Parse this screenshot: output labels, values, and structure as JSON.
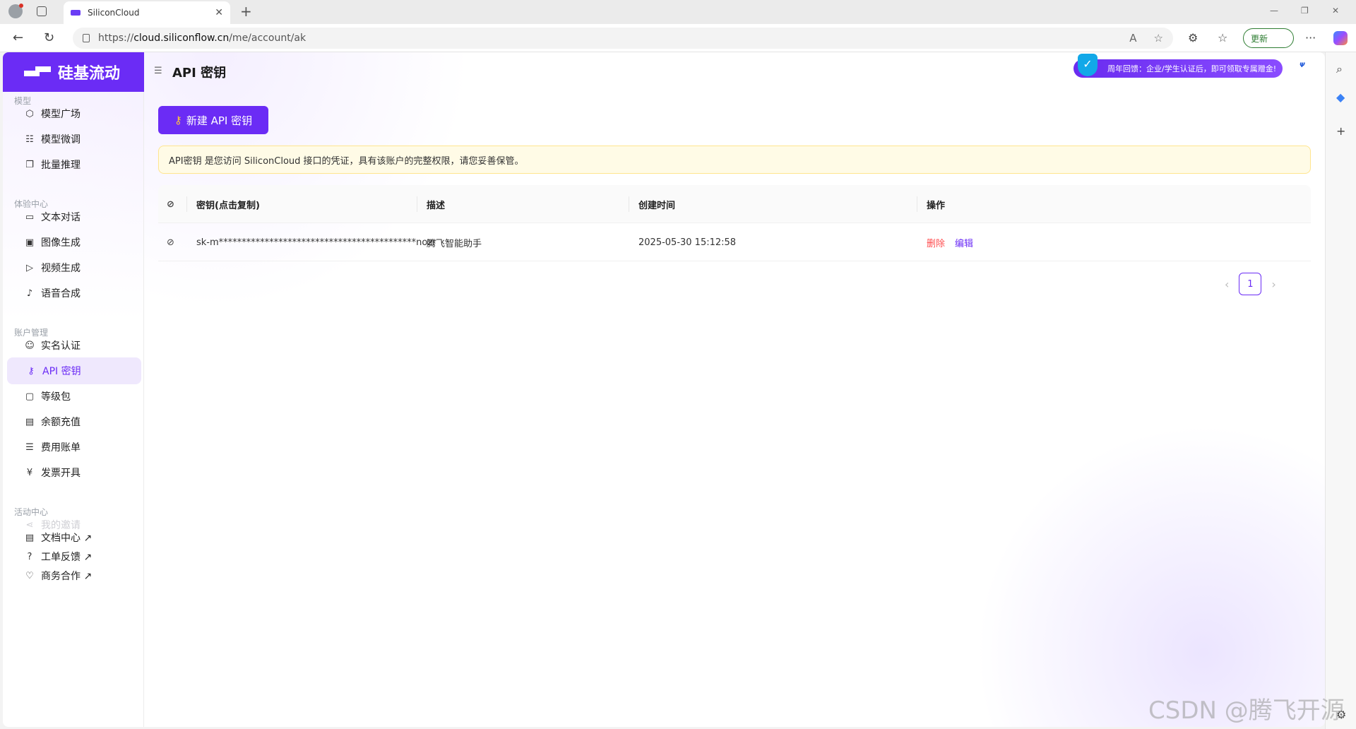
{
  "browser": {
    "tab_title": "SiliconCloud",
    "url_prefix": "https://",
    "url_host": "cloud.siliconflow.cn",
    "url_path": "/me/account/ak",
    "update_label": "更新"
  },
  "brand": {
    "name": "硅基流动"
  },
  "sidebar": {
    "sections": [
      {
        "title": "模型"
      },
      {
        "title": "体验中心"
      },
      {
        "title": "账户管理"
      },
      {
        "title": "活动中心"
      }
    ],
    "items": [
      {
        "label": "模型广场",
        "icon": "cube-icon"
      },
      {
        "label": "模型微调",
        "icon": "sliders-icon"
      },
      {
        "label": "批量推理",
        "icon": "copy-icon"
      },
      {
        "label": "文本对话",
        "icon": "chat-icon"
      },
      {
        "label": "图像生成",
        "icon": "image-icon"
      },
      {
        "label": "视频生成",
        "icon": "video-icon"
      },
      {
        "label": "语音合成",
        "icon": "mic-icon"
      },
      {
        "label": "实名认证",
        "icon": "user-check-icon"
      },
      {
        "label": "API 密钥",
        "icon": "key-icon"
      },
      {
        "label": "等级包",
        "icon": "wallet-icon"
      },
      {
        "label": "余额充值",
        "icon": "card-icon"
      },
      {
        "label": "费用账单",
        "icon": "bill-icon"
      },
      {
        "label": "发票开具",
        "icon": "invoice-icon"
      },
      {
        "label": "我的邀请",
        "icon": "share-icon"
      }
    ],
    "footer_links": [
      {
        "label": "文档中心 ↗",
        "icon": "doc-icon"
      },
      {
        "label": "工单反馈 ↗",
        "icon": "help-icon"
      },
      {
        "label": "商务合作 ↗",
        "icon": "handshake-icon"
      }
    ],
    "active_item": "API 密钥"
  },
  "header": {
    "title": "API 密钥",
    "promo_text": "周年回馈：企业/学生认证后，即可领取专属赠金!",
    "corner_logo": "Ψ"
  },
  "content": {
    "new_key_button": "新建 API 密钥",
    "notice": "API密钥 是您访问 SiliconCloud 接口的凭证，具有该账户的完整权限，请您妥善保管。",
    "table": {
      "columns": [
        "密钥(点击复制)",
        "描述",
        "创建时间",
        "操作"
      ],
      "rows": [
        {
          "key": "sk-m*******************************************nozr",
          "description": "腾飞智能助手",
          "created": "2025-05-30 15:12:58",
          "actions": [
            "删除",
            "编辑"
          ]
        }
      ]
    },
    "pagination": {
      "current": "1"
    }
  },
  "watermark": "CSDN @腾飞开源",
  "colors": {
    "brand": "#6b2cf5",
    "danger": "#ff4d4f",
    "notice_bg": "#fffbe6"
  }
}
